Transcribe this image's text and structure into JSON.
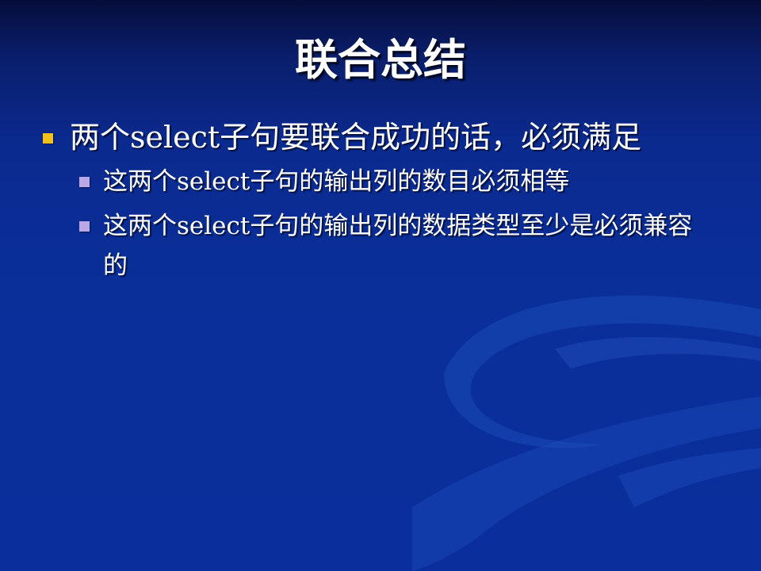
{
  "slide": {
    "title": "联合总结",
    "colors": {
      "background": "#0a2f99",
      "text": "#ffffff",
      "bullet_level1": "#f2c11a",
      "bullet_level2": "#b9a7e6"
    },
    "bullets": [
      {
        "text": "两个select子句要联合成功的话，必须满足",
        "sub": [
          {
            "text": "这两个select子句的输出列的数目必须相等"
          },
          {
            "text": "这两个select子句的输出列的数据类型至少是必须兼容的"
          }
        ]
      }
    ]
  }
}
